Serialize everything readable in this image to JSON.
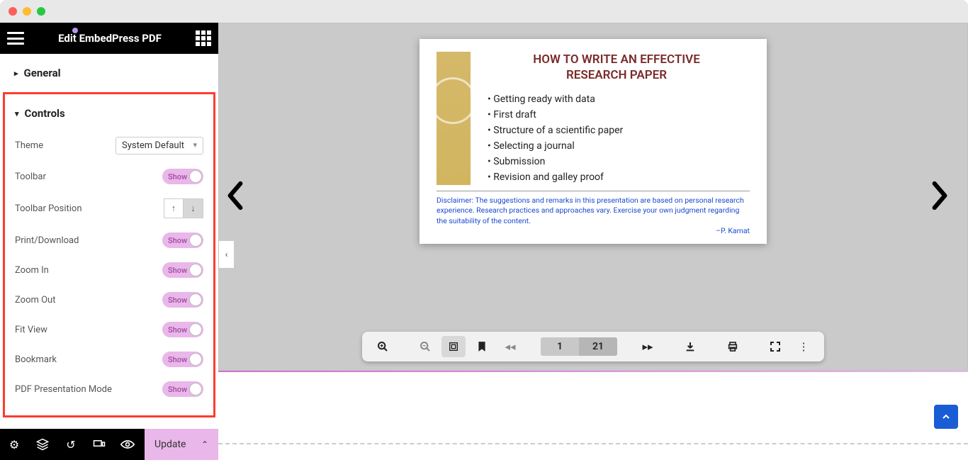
{
  "header": {
    "title": "Edit EmbedPress PDF"
  },
  "sections": {
    "general": {
      "label": "General"
    },
    "controls": {
      "label": "Controls"
    }
  },
  "controls": {
    "theme_label": "Theme",
    "theme_value": "System Default",
    "toolbar_label": "Toolbar",
    "toolbar_position_label": "Toolbar Position",
    "print_download_label": "Print/Download",
    "zoom_in_label": "Zoom In",
    "zoom_out_label": "Zoom Out",
    "fit_view_label": "Fit View",
    "bookmark_label": "Bookmark",
    "presentation_label": "PDF Presentation Mode",
    "toggle_on_label": "Show"
  },
  "update_label": "Update",
  "slide": {
    "title_line1": "HOW TO WRITE AN EFFECTIVE",
    "title_line2": "RESEARCH PAPER",
    "bullets": [
      "Getting ready with data",
      "First draft",
      "Structure of a scientific paper",
      "Selecting a journal",
      "Submission",
      "Revision and galley proof"
    ],
    "disclaimer": "Disclaimer: The suggestions and remarks in this presentation are based on personal research experience. Research practices and approaches vary. Exercise your own judgment regarding the suitability of the content.",
    "author": "–P. Kamat"
  },
  "pager": {
    "current": "1",
    "total": "21"
  }
}
